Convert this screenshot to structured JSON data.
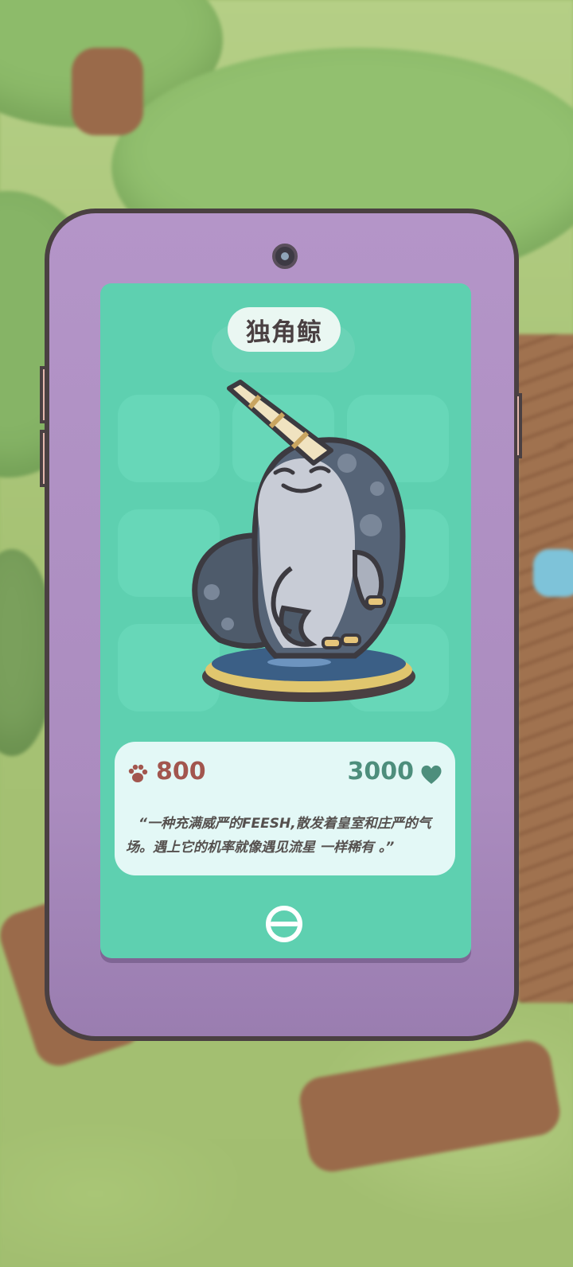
{
  "card": {
    "title": "独角鲸",
    "paw_price": "800",
    "heart_price": "3000",
    "description": "“一种充满威严的FEESH,散发着皇室和庄严的气场。遇上它的机率就像遇见流星 一样稀有 。”"
  },
  "icons": {
    "paw": "paw-icon",
    "heart": "heart-icon",
    "close": "close-icon"
  },
  "colors": {
    "phone": "#b495c8",
    "screen": "#5ed0b0",
    "paw_price": "#a2564e",
    "heart_price": "#4d8e7c"
  }
}
